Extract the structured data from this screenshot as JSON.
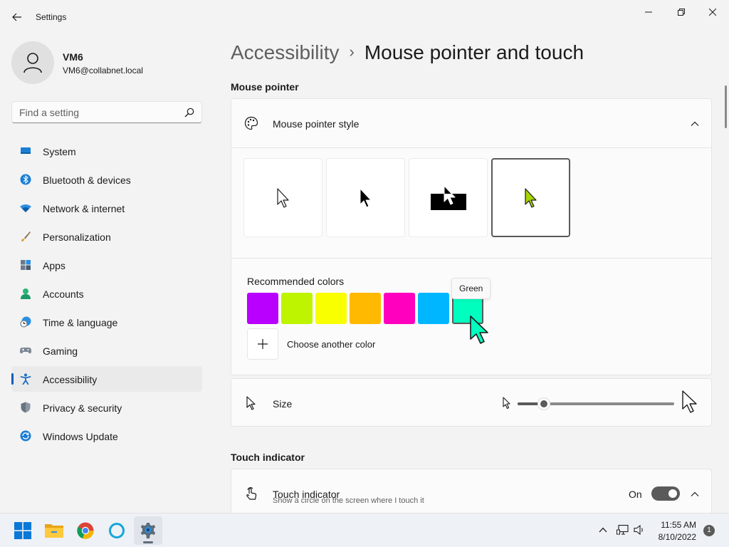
{
  "window": {
    "title": "Settings",
    "back_icon": "arrow-left-icon",
    "minimize_icon": "minimize-icon",
    "maximize_icon": "restore-icon",
    "close_icon": "close-icon"
  },
  "profile": {
    "name": "VM6",
    "email": "VM6@collabnet.local",
    "avatar_icon": "person-icon"
  },
  "search": {
    "placeholder": "Find a setting",
    "value": "",
    "icon": "search-icon"
  },
  "sidebar": {
    "items": [
      {
        "label": "System",
        "icon": "system-icon",
        "active": false
      },
      {
        "label": "Bluetooth & devices",
        "icon": "bluetooth-icon",
        "active": false
      },
      {
        "label": "Network & internet",
        "icon": "wifi-icon",
        "active": false
      },
      {
        "label": "Personalization",
        "icon": "brush-icon",
        "active": false
      },
      {
        "label": "Apps",
        "icon": "apps-icon",
        "active": false
      },
      {
        "label": "Accounts",
        "icon": "accounts-icon",
        "active": false
      },
      {
        "label": "Time & language",
        "icon": "clock-globe-icon",
        "active": false
      },
      {
        "label": "Gaming",
        "icon": "gamepad-icon",
        "active": false
      },
      {
        "label": "Accessibility",
        "icon": "accessibility-icon",
        "active": true
      },
      {
        "label": "Privacy & security",
        "icon": "shield-icon",
        "active": false
      },
      {
        "label": "Windows Update",
        "icon": "update-icon",
        "active": false
      }
    ]
  },
  "breadcrumb": {
    "parent": "Accessibility",
    "separator": "›",
    "current": "Mouse pointer and touch"
  },
  "mouse_pointer": {
    "section_title": "Mouse pointer",
    "style_card": {
      "label": "Mouse pointer style",
      "icon": "palette-icon",
      "expanded": true,
      "styles": [
        {
          "name": "white",
          "selected": false
        },
        {
          "name": "black",
          "selected": false
        },
        {
          "name": "inverted",
          "selected": false
        },
        {
          "name": "custom",
          "selected": true,
          "color": "#a8d400"
        }
      ],
      "recommended_label": "Recommended colors",
      "colors": [
        {
          "name": "Purple",
          "hex": "#b900ff",
          "selected": false
        },
        {
          "name": "Lime",
          "hex": "#bef400",
          "selected": false
        },
        {
          "name": "Yellow",
          "hex": "#faff00",
          "selected": false
        },
        {
          "name": "Gold",
          "hex": "#ffb900",
          "selected": false
        },
        {
          "name": "Pink",
          "hex": "#ff00bf",
          "selected": false
        },
        {
          "name": "Turquoise",
          "hex": "#00b7ff",
          "selected": false
        },
        {
          "name": "Green",
          "hex": "#00ffbf",
          "selected": true
        }
      ],
      "tooltip": "Green",
      "choose_another_label": "Choose another color",
      "choose_another_icon": "plus-icon"
    },
    "size_card": {
      "label": "Size",
      "icon": "pointer-icon",
      "min_icon": "small-pointer-icon",
      "max_icon": "large-pointer-icon",
      "value_fraction": 0.17
    }
  },
  "touch": {
    "section_title": "Touch indicator",
    "card": {
      "label": "Touch indicator",
      "description": "Show a circle on the screen where I touch it",
      "icon": "touch-icon",
      "state": "On",
      "on": true
    }
  },
  "taskbar": {
    "apps": [
      {
        "name": "start",
        "icon": "windows-logo-icon",
        "active": false
      },
      {
        "name": "file-explorer",
        "icon": "folder-icon",
        "active": false
      },
      {
        "name": "chrome",
        "icon": "chrome-icon",
        "active": false
      },
      {
        "name": "cortana",
        "icon": "cortana-icon",
        "active": false
      },
      {
        "name": "settings",
        "icon": "gear-icon",
        "active": true
      }
    ],
    "tray_icons": [
      "chevron-up-icon",
      "network-icon",
      "volume-icon"
    ],
    "time": "11:55 AM",
    "date": "8/10/2022",
    "notification_count": "1"
  }
}
